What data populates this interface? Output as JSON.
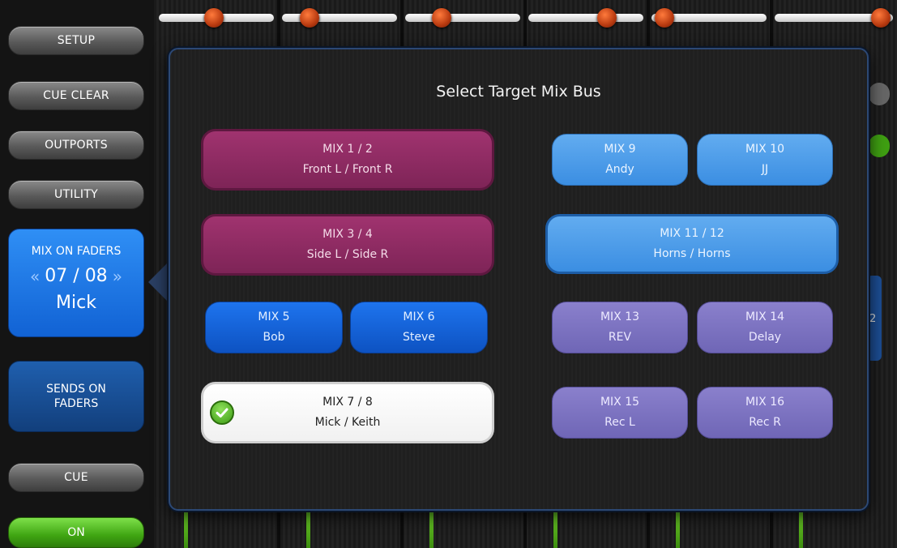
{
  "sidebar": {
    "setup": "SETUP",
    "cue_clear": "CUE CLEAR",
    "outports": "OUTPORTS",
    "utility": "UTILITY",
    "mix_on_faders": {
      "label": "MIX ON FADERS",
      "prev_icon": "«",
      "current": "07 / 08",
      "next_icon": "»",
      "name": "Mick"
    },
    "sends_on_faders": {
      "line1": "SENDS ON",
      "line2": "FADERS"
    },
    "cue": "CUE",
    "on": "ON"
  },
  "background": {
    "peek_number": "2"
  },
  "popup": {
    "title": "Select Target Mix Bus",
    "buses": [
      {
        "id": "mix-1-2",
        "label": "MIX 1 / 2",
        "name": "Front L / Front R"
      },
      {
        "id": "mix-3-4",
        "label": "MIX 3 / 4",
        "name": "Side L / Side R"
      },
      {
        "id": "mix-5",
        "label": "MIX 5",
        "name": "Bob"
      },
      {
        "id": "mix-6",
        "label": "MIX 6",
        "name": "Steve"
      },
      {
        "id": "mix-7-8",
        "label": "MIX 7 / 8",
        "name": "Mick / Keith",
        "selected": true
      },
      {
        "id": "mix-9",
        "label": "MIX 9",
        "name": "Andy"
      },
      {
        "id": "mix-10",
        "label": "MIX 10",
        "name": "JJ"
      },
      {
        "id": "mix-11-12",
        "label": "MIX 11 / 12",
        "name": "Horns / Horns"
      },
      {
        "id": "mix-13",
        "label": "MIX 13",
        "name": "REV"
      },
      {
        "id": "mix-14",
        "label": "MIX 14",
        "name": "Delay"
      },
      {
        "id": "mix-15",
        "label": "MIX 15",
        "name": "Rec L"
      },
      {
        "id": "mix-16",
        "label": "MIX 16",
        "name": "Rec R"
      }
    ]
  },
  "colors": {
    "stereo_mix": "#8e2b63",
    "mono_mix": "#1462d8",
    "light_mix": "#4f9de9",
    "fx_mix": "#7d74c2",
    "on_green": "#4cb81a",
    "fader_knob": "#d4531f"
  }
}
